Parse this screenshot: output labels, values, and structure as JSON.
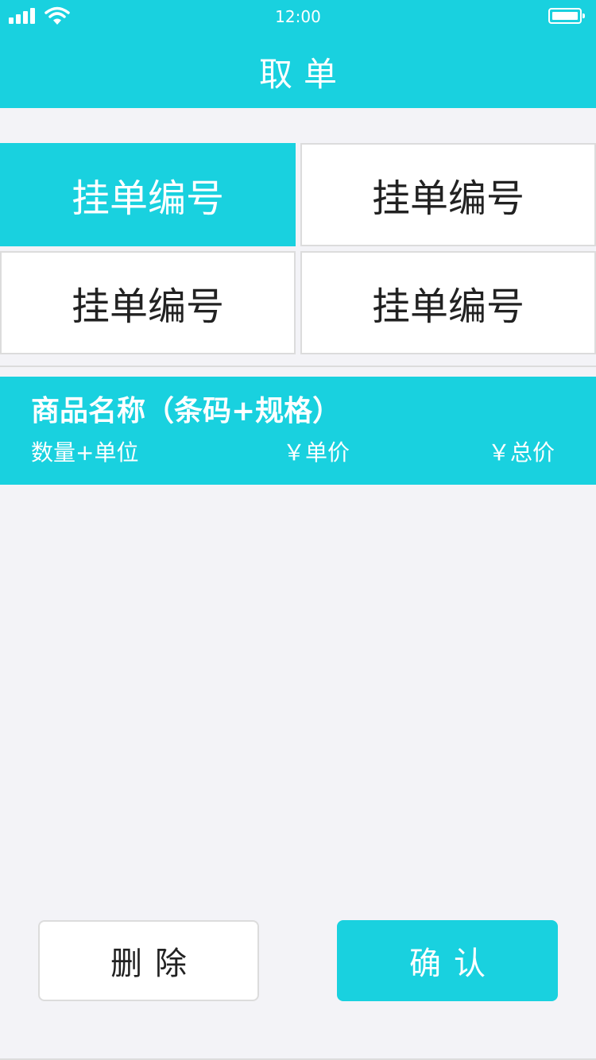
{
  "status_bar": {
    "time": "12:00",
    "signal_icon": "cellular-signal-icon",
    "wifi_icon": "wifi-icon",
    "battery_icon": "battery-icon"
  },
  "header": {
    "title": "取单"
  },
  "orders": [
    {
      "label": "挂单编号",
      "selected": true
    },
    {
      "label": "挂单编号",
      "selected": false
    },
    {
      "label": "挂单编号",
      "selected": false
    },
    {
      "label": "挂单编号",
      "selected": false
    }
  ],
  "product": {
    "name": "商品名称（条码+规格）",
    "quantity": "数量+单位",
    "unit_price": "￥单价",
    "total_price": "￥总价"
  },
  "actions": {
    "delete_label": "删除",
    "confirm_label": "确认"
  },
  "colors": {
    "accent": "#19d1df",
    "background": "#f3f3f7",
    "border": "#dcdcdc"
  }
}
